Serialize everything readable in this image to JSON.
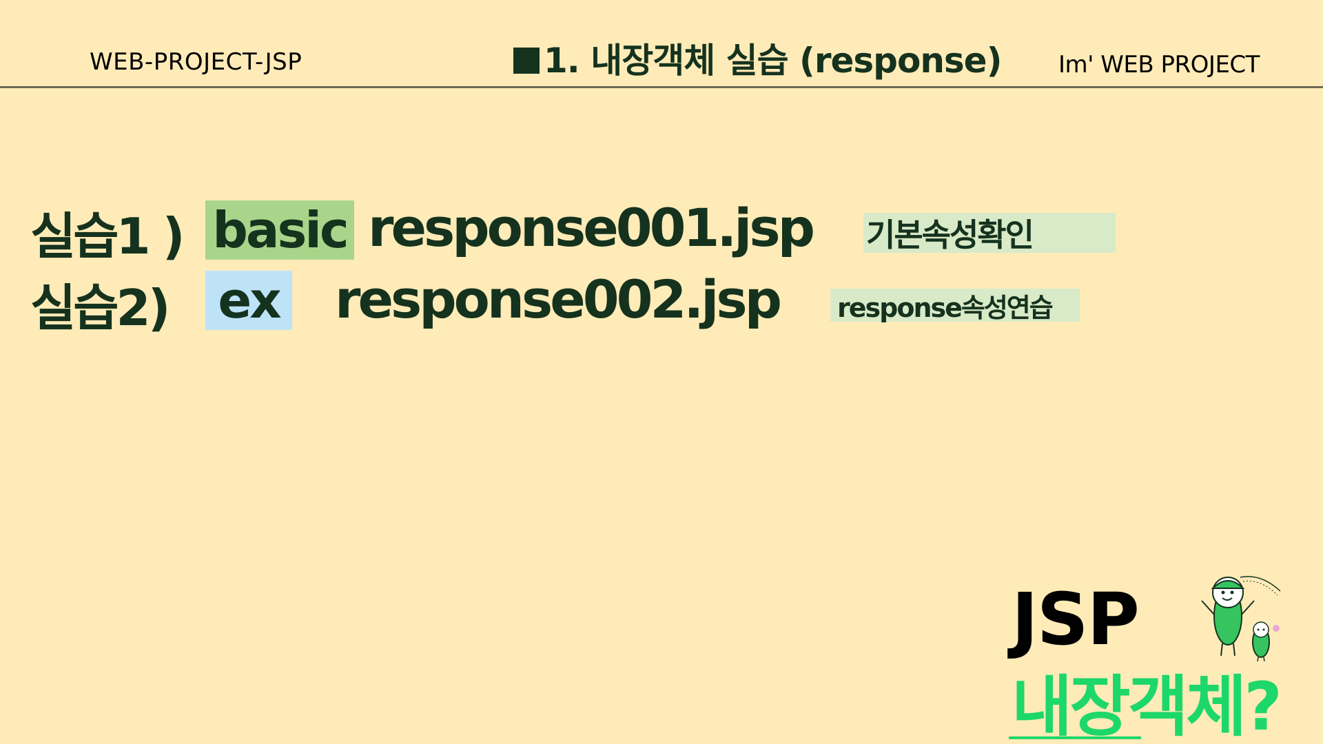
{
  "colors": {
    "background": "#FFEBB8",
    "text_dark": "#15321E",
    "divider": "#6E6753",
    "basic_tag_bg": "#A9D58A",
    "ex_tag_bg": "#BEE3F7",
    "note_bg": "#D9EAC8",
    "accent_green": "#1ED76B",
    "mascot_green": "#35C45F",
    "black": "#000000"
  },
  "header": {
    "left_text": "WEB-PROJECT-JSP",
    "title": "1. 내장객체 실습 (response)",
    "right_text": "Im'  WEB PROJECT",
    "square_icon": "filled-square-icon"
  },
  "exercises": [
    {
      "label": "실습1 )",
      "tag": "basic",
      "filename": "response001.jsp",
      "note": "기본속성확인"
    },
    {
      "label": "실습2)",
      "tag": "ex",
      "filename": "response002.jsp",
      "note": "response속성연습"
    }
  ],
  "branding": {
    "jsp": "JSP",
    "subtitle": "내장객체?",
    "mascot_icon": "bean-mascot-icon"
  }
}
